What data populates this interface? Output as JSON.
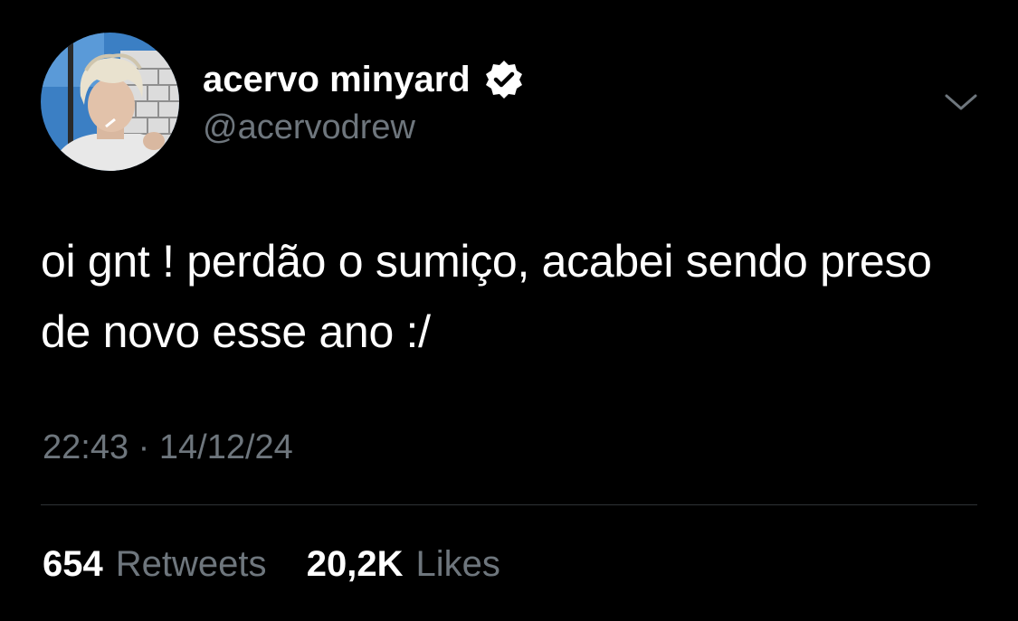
{
  "user": {
    "display_name": "acervo minyard",
    "handle": "@acervodrew",
    "verified": true
  },
  "tweet": {
    "text": "oi gnt ! perdão o sumiço, acabei sendo preso de novo esse ano :/",
    "time": "22:43",
    "separator": "·",
    "date": "14/12/24"
  },
  "stats": {
    "retweets_count": "654",
    "retweets_label": "Retweets",
    "likes_count": "20,2K",
    "likes_label": "Likes"
  },
  "icons": {
    "verified": "verified-badge-icon",
    "menu": "chevron-down-icon"
  },
  "colors": {
    "background": "#000000",
    "text": "#ffffff",
    "muted": "#6e767d",
    "divider": "#2f3336"
  }
}
